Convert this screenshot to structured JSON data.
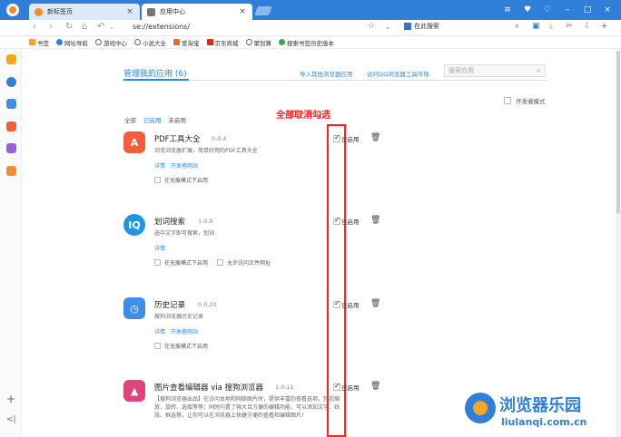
{
  "tabs": [
    {
      "title": "新标签页",
      "close": "×"
    },
    {
      "title": "应用中心",
      "close": "×"
    }
  ],
  "window_controls": [
    "≡",
    "♥",
    "♡",
    "–",
    "□",
    "×"
  ],
  "address": {
    "url": "se://extensions/",
    "search_engine": "在此搜索"
  },
  "bookmarks": [
    "书签",
    "网址导航",
    "游戏中心",
    "小说大全",
    "爱淘宝",
    "京东商城",
    "聚划算",
    "搜索书签历史版本"
  ],
  "page": {
    "title": "管理我的应用 (6)",
    "link_import": "导入其他浏览器应用",
    "link_store": "访问QQ浏览器工具市场",
    "search_placeholder": "搜索应用",
    "dev_mode": "开发者模式",
    "filters": [
      "全部",
      "已启用",
      "未启用"
    ],
    "annotation": "全部取消勾选"
  },
  "extensions": [
    {
      "name": "PDF工具大全",
      "version": "0.0.4",
      "desc": "浏览浏览器扩展，简单好用的PDF工具大全",
      "links": [
        "详情",
        "开发者网站"
      ],
      "options": [
        "在无痕模式下启用"
      ],
      "enabled_label": "已启用"
    },
    {
      "name": "划词搜索",
      "version": "1.0.9",
      "desc": "选中文字即可搜索，划词",
      "links": [
        "详情"
      ],
      "options": [
        "在无痕模式下启用",
        "允许访问文件网址"
      ],
      "enabled_label": "已启用"
    },
    {
      "name": "历史记录",
      "version": "0.0.10",
      "desc": "搜狗浏览器历史记录",
      "links": [
        "详情",
        "开发者网站"
      ],
      "options": [
        "在无痕模式下启用"
      ],
      "enabled_label": "已启用"
    },
    {
      "name": "图片查看编辑器 via 搜狗浏览器",
      "version": "1.0.11",
      "desc": "【搜狗浏览器出品】在访问本地和网络图片时，提供丰富的查看选项，包括缩放、旋转、选取等等；同时内置了强大且方便的编辑功能，可以添加文字、线段、框选等，让你可以在浏览器上快捷方便的查看和编辑图片！",
      "links": [],
      "options": [],
      "enabled_label": "已启用"
    }
  ],
  "sidebar_bottom": [
    "+",
    "<|"
  ],
  "watermark": {
    "title": "浏览器乐园",
    "url": "liulanqi.com.cn"
  },
  "colors": {
    "accent": "#2b8be0",
    "titlebar": "#2f7fd8",
    "annotation": "#ff2020"
  }
}
